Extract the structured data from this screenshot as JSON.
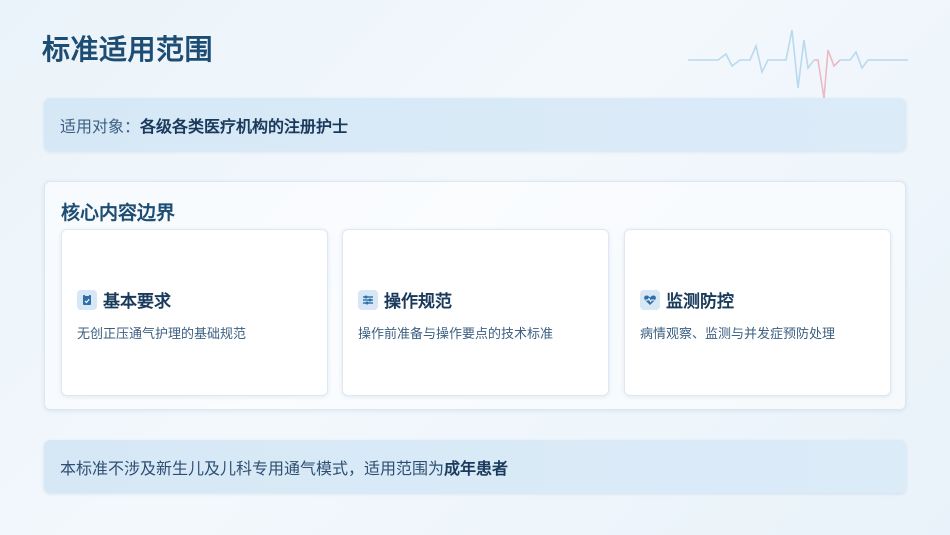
{
  "page": {
    "title": "标准适用范围"
  },
  "scope": {
    "prefix": "适用对象：",
    "value": "各级各类医疗机构的注册护士"
  },
  "core": {
    "title": "核心内容边界",
    "cards": [
      {
        "icon": "clipboard-icon",
        "title": "基本要求",
        "desc": "无创正压通气护理的基础规范"
      },
      {
        "icon": "sliders-icon",
        "title": "操作规范",
        "desc": "操作前准备与操作要点的技术标准"
      },
      {
        "icon": "heart-pulse-icon",
        "title": "监测防控",
        "desc": "病情观察、监测与并发症预防处理"
      }
    ]
  },
  "note": {
    "text": "本标准不涉及新生儿及儿科专用通气模式，适用范围为",
    "strong": "成年患者"
  },
  "colors": {
    "title": "#1e4d73",
    "accent_bar": "#d6e8f6",
    "icon_bg": "#d7e7f6",
    "icon_fg": "#2f6fa8",
    "ecg_blue": "#8cc2e6",
    "ecg_red": "#e88a94"
  }
}
